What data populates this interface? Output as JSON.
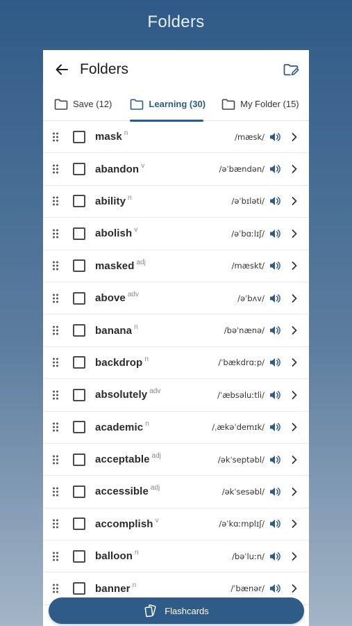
{
  "app": {
    "title": "Folders"
  },
  "header": {
    "title": "Folders"
  },
  "tabs": [
    {
      "label": "Save (12)",
      "active": false
    },
    {
      "label": "Learning (30)",
      "active": true
    },
    {
      "label": "My Folder (15)",
      "active": false
    }
  ],
  "words": [
    {
      "word": "mask",
      "pos": "n",
      "ipa": "/mæsk/"
    },
    {
      "word": "abandon",
      "pos": "v",
      "ipa": "/əˈbændən/"
    },
    {
      "word": "ability",
      "pos": "n",
      "ipa": "/əˈbɪləti/"
    },
    {
      "word": "abolish",
      "pos": "v",
      "ipa": "/əˈbɑːlɪʃ/"
    },
    {
      "word": "masked",
      "pos": "adj",
      "ipa": "/mæskt/"
    },
    {
      "word": "above",
      "pos": "adv",
      "ipa": "/əˈbʌv/"
    },
    {
      "word": "banana",
      "pos": "n",
      "ipa": "/bəˈnænə/"
    },
    {
      "word": "backdrop",
      "pos": "n",
      "ipa": "/ˈbækdrɑːp/"
    },
    {
      "word": "absolutely",
      "pos": "adv",
      "ipa": "/ˈæbsəluːtli/"
    },
    {
      "word": "academic",
      "pos": "n",
      "ipa": "/ˌækəˈdemɪk/"
    },
    {
      "word": "acceptable",
      "pos": "adj",
      "ipa": "/əkˈseptəbl/"
    },
    {
      "word": "accessible",
      "pos": "adj",
      "ipa": "/əkˈsesəbl/"
    },
    {
      "word": "accomplish",
      "pos": "v",
      "ipa": "/əˈkɑːmplɪʃ/"
    },
    {
      "word": "balloon",
      "pos": "n",
      "ipa": "/bəˈluːn/"
    },
    {
      "word": "banner",
      "pos": "n",
      "ipa": "/ˈbænər/"
    }
  ],
  "flashcards_button": {
    "label": "Flashcards"
  },
  "colors": {
    "accent": "#2e5b88",
    "background_top": "#2f5a87",
    "background_bottom": "#a3b5c6"
  }
}
